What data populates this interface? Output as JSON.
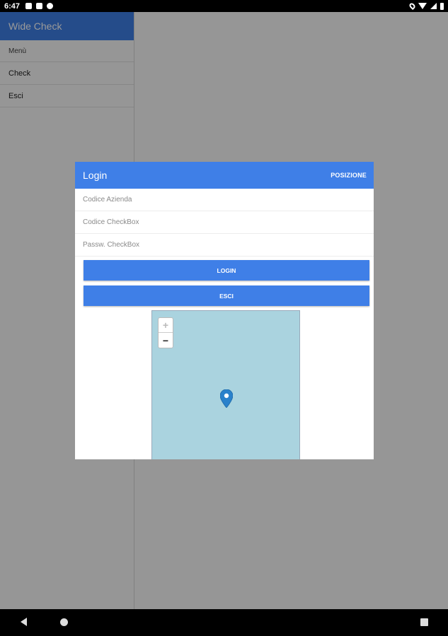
{
  "status_bar": {
    "time": "6:47"
  },
  "app": {
    "title": "Wide Check"
  },
  "drawer": {
    "section_label": "Menù",
    "items": [
      {
        "label": "Check"
      },
      {
        "label": "Esci"
      }
    ]
  },
  "login_dialog": {
    "title": "Login",
    "position_action": "POSIZIONE",
    "fields": {
      "company_code_placeholder": "Codice Azienda",
      "checkbox_code_placeholder": "Codice CheckBox",
      "checkbox_password_placeholder": "Passw. CheckBox"
    },
    "login_button": "LOGIN",
    "exit_button": "ESCI"
  },
  "map": {
    "zoom_in": "+",
    "zoom_out": "−",
    "water_color": "#aad3df",
    "marker_color": "#2a81cb"
  },
  "theme": {
    "primary": "#3f7fe7"
  }
}
